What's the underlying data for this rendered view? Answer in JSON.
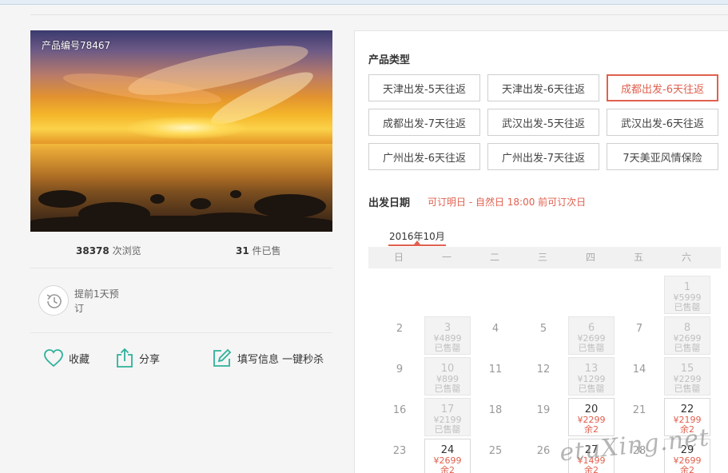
{
  "product": {
    "code_label": "产品编号78467"
  },
  "stats": {
    "views_count": "38378",
    "views_unit": " 次浏览",
    "sold_count": "31",
    "sold_unit": " 件已售"
  },
  "advance": {
    "text": "提前1天预订"
  },
  "actions": {
    "favorite": "收藏",
    "share": "分享",
    "fill_info": "填写信息 一键秒杀"
  },
  "types": {
    "title": "产品类型",
    "options": [
      {
        "label": "天津出发-5天往返",
        "selected": false
      },
      {
        "label": "天津出发-6天往返",
        "selected": false
      },
      {
        "label": "成都出发-6天往返",
        "selected": true
      },
      {
        "label": "成都出发-7天往返",
        "selected": false
      },
      {
        "label": "武汉出发-5天往返",
        "selected": false
      },
      {
        "label": "武汉出发-6天往返",
        "selected": false
      },
      {
        "label": "广州出发-6天往返",
        "selected": false
      },
      {
        "label": "广州出发-7天往返",
        "selected": false
      },
      {
        "label": "7天美亚风情保险",
        "selected": false
      }
    ]
  },
  "departure": {
    "title": "出发日期",
    "note": "可订明日 - 自然日 18:00 前可订次日"
  },
  "calendar": {
    "month_label": "2016年10月",
    "weekdays": [
      "日",
      "一",
      "二",
      "三",
      "四",
      "五",
      "六"
    ],
    "rows": [
      [
        null,
        null,
        null,
        null,
        null,
        null,
        {
          "day": "1",
          "price": "¥5999",
          "status": "已售罄",
          "kind": "soldout"
        }
      ],
      [
        {
          "day": "2",
          "kind": "plain"
        },
        {
          "day": "3",
          "price": "¥4899",
          "status": "已售罄",
          "kind": "soldout"
        },
        {
          "day": "4",
          "kind": "plain"
        },
        {
          "day": "5",
          "kind": "plain"
        },
        {
          "day": "6",
          "price": "¥2699",
          "status": "已售罄",
          "kind": "soldout"
        },
        {
          "day": "7",
          "kind": "plain"
        },
        {
          "day": "8",
          "price": "¥2699",
          "status": "已售罄",
          "kind": "soldout"
        }
      ],
      [
        {
          "day": "9",
          "kind": "plain"
        },
        {
          "day": "10",
          "price": "¥899",
          "status": "已售罄",
          "kind": "soldout"
        },
        {
          "day": "11",
          "kind": "plain"
        },
        {
          "day": "12",
          "kind": "plain"
        },
        {
          "day": "13",
          "price": "¥1299",
          "status": "已售罄",
          "kind": "soldout"
        },
        {
          "day": "14",
          "kind": "plain"
        },
        {
          "day": "15",
          "price": "¥2299",
          "status": "已售罄",
          "kind": "soldout"
        }
      ],
      [
        {
          "day": "16",
          "kind": "plain"
        },
        {
          "day": "17",
          "price": "¥2199",
          "status": "已售罄",
          "kind": "soldout"
        },
        {
          "day": "18",
          "kind": "plain"
        },
        {
          "day": "19",
          "kind": "plain"
        },
        {
          "day": "20",
          "price": "¥2299",
          "status": "余2",
          "kind": "avail"
        },
        {
          "day": "21",
          "kind": "plain"
        },
        {
          "day": "22",
          "price": "¥2199",
          "status": "余2",
          "kind": "avail"
        }
      ],
      [
        {
          "day": "23",
          "kind": "plain"
        },
        {
          "day": "24",
          "price": "¥2699",
          "status": "余2",
          "kind": "avail"
        },
        {
          "day": "25",
          "kind": "plain"
        },
        {
          "day": "26",
          "kind": "plain"
        },
        {
          "day": "27",
          "price": "¥1499",
          "status": "余2",
          "kind": "avail"
        },
        {
          "day": "28",
          "kind": "plain"
        },
        {
          "day": "29",
          "price": "¥2699",
          "status": "余2",
          "kind": "avail"
        }
      ]
    ]
  },
  "watermark": "etuXing.net"
}
